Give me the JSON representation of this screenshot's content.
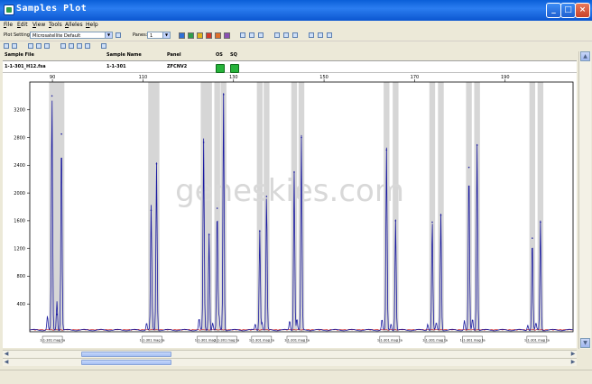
{
  "window": {
    "title": "Samples Plot"
  },
  "menu": [
    "File",
    "Edit",
    "View",
    "Tools",
    "Alleles",
    "Help"
  ],
  "toolbar": {
    "plot_setting_label": "Plot Setting:",
    "plot_setting_value": "Microsatellite Default",
    "panes_label": "Panes:",
    "panes_value": "1",
    "color_swatches": [
      "#2f6fd6",
      "#2f9e4a",
      "#e2b31a",
      "#d43a2a",
      "#e0702a",
      "#8a4fb3"
    ]
  },
  "table": {
    "headers": [
      "Sample File",
      "Sample Name",
      "Panel",
      "OS",
      "SQ"
    ],
    "row": {
      "sample_file": "1-1-301_H12.fsa",
      "sample_name": "1-1-301",
      "panel": "ZFCNV2"
    }
  },
  "watermark": "geneskies.com",
  "chart_data": {
    "type": "line",
    "x_ticks": [
      90,
      110,
      130,
      150,
      170,
      190
    ],
    "y_ticks": [
      400,
      800,
      1200,
      1600,
      2000,
      2400,
      2800,
      3200
    ],
    "xlim": [
      85,
      205
    ],
    "ylim": [
      0,
      3600
    ],
    "grid": false,
    "peaks": [
      {
        "x": 89.9,
        "y": 3400
      },
      {
        "x": 91.0,
        "y": 250
      },
      {
        "x": 92.0,
        "y": 2850
      },
      {
        "x": 111.8,
        "y": 1750
      },
      {
        "x": 113.0,
        "y": 2420
      },
      {
        "x": 123.4,
        "y": 2730
      },
      {
        "x": 124.6,
        "y": 1400
      },
      {
        "x": 126.4,
        "y": 1780
      },
      {
        "x": 127.8,
        "y": 3420
      },
      {
        "x": 135.8,
        "y": 1450
      },
      {
        "x": 137.3,
        "y": 1950
      },
      {
        "x": 143.4,
        "y": 2300
      },
      {
        "x": 145.0,
        "y": 2800
      },
      {
        "x": 163.8,
        "y": 2620
      },
      {
        "x": 165.8,
        "y": 1600
      },
      {
        "x": 173.9,
        "y": 1580
      },
      {
        "x": 175.8,
        "y": 1680
      },
      {
        "x": 182.0,
        "y": 2370
      },
      {
        "x": 183.8,
        "y": 2690
      },
      {
        "x": 196.0,
        "y": 1350
      },
      {
        "x": 197.8,
        "y": 1580
      }
    ],
    "bins": [
      {
        "x": 90.0,
        "label": "1-1-301 mag ta"
      },
      {
        "x": 112.0,
        "label": "1-1-301 mag ta"
      },
      {
        "x": 124.2,
        "label": "1-1-301 mag ta"
      },
      {
        "x": 128.5,
        "label": "1-1-301 mag ta"
      },
      {
        "x": 136.2,
        "label": "1-1-301 mag ta"
      },
      {
        "x": 144.0,
        "label": "1-1-301 mag ta"
      },
      {
        "x": 164.5,
        "label": "1-1-301 mag ta"
      },
      {
        "x": 174.5,
        "label": "1-1-301 mag ta"
      },
      {
        "x": 182.8,
        "label": "1-1-301 mag ta"
      },
      {
        "x": 197.0,
        "label": "1-1-301 mag ta"
      }
    ]
  }
}
